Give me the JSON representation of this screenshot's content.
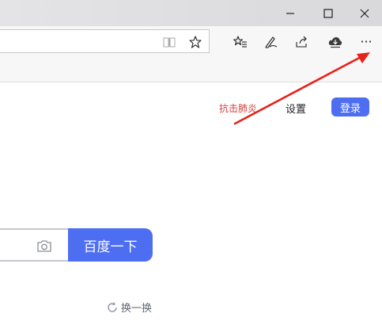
{
  "window": {
    "minimize_icon": "minimize-icon",
    "maximize_icon": "maximize-icon",
    "close_icon": "close-icon"
  },
  "toolbar": {
    "icons": [
      "reading-view-icon",
      "favorite-star-icon",
      "favorites-list-icon",
      "pen-icon",
      "share-icon",
      "download-cloud-icon",
      "more-icon"
    ],
    "more_label": "···"
  },
  "page": {
    "link_red": "抗击肺炎",
    "settings": "设置",
    "login": "登录",
    "search_button": "百度一下",
    "refresh": "换一换"
  },
  "colors": {
    "accent": "#4e6ef2",
    "red_link": "#d0413b",
    "annotation_arrow": "#e8211a"
  }
}
